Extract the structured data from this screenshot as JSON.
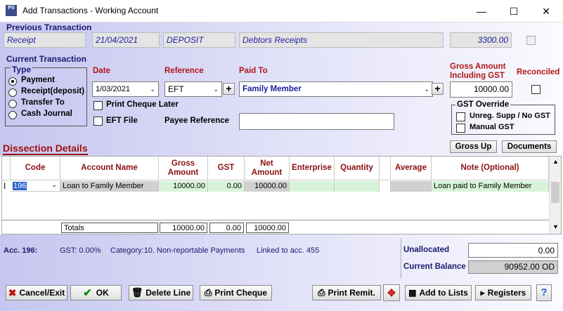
{
  "window": {
    "title": "Add Transactions - Working Account",
    "icon_text": "PS"
  },
  "previous": {
    "title": "Previous Transaction",
    "type": "Receipt",
    "date": "21/04/2021",
    "reference": "DEPOSIT",
    "paid_to": "Debtors Receipts",
    "amount": "3300.00"
  },
  "current": {
    "title": "Current Transaction",
    "type_title": "Type",
    "types": [
      "Payment",
      "Receipt(deposit)",
      "Transfer To",
      "Cash Journal"
    ],
    "selected_type": "Payment",
    "date_label": "Date",
    "date_value": "1/03/2021",
    "reference_label": "Reference",
    "reference_value": "EFT",
    "paid_to_label": "Paid To",
    "paid_to_value": "Family Member",
    "gross_label": "Gross Amount Including GST",
    "gross_value": "10000.00",
    "reconciled_label": "Reconciled",
    "print_cheque_later": "Print Cheque Later",
    "eft_file": "EFT File",
    "payee_reference_label": "Payee Reference",
    "payee_reference_value": "",
    "gst_override_title": "GST Override",
    "unreg_supp": "Unreg. Supp / No GST",
    "manual_gst": "Manual GST",
    "gross_up_button": "Gross Up",
    "documents_button": "Documents"
  },
  "dissection": {
    "title": "Dissection Details",
    "columns": [
      "Code",
      "Account Name",
      "Gross Amount",
      "GST",
      "Net Amount",
      "Enterprise",
      "Quantity",
      "Average",
      "Note (Optional)"
    ],
    "row": {
      "code": "196",
      "account_name": "Loan to Family Member",
      "gross": "10000.00",
      "gst": "0.00",
      "net": "10000.00",
      "enterprise": "",
      "quantity": "",
      "average": "",
      "note": "Loan paid to Family Member"
    },
    "totals_label": "Totals",
    "totals": {
      "gross": "10000.00",
      "gst": "0.00",
      "net": "10000.00"
    }
  },
  "info": {
    "account": "Acc. 196:",
    "gst": "GST: 0.00%",
    "category": "Category:10. Non-reportable Payments",
    "linked": "Linked to acc. 455",
    "unallocated_label": "Unallocated",
    "unallocated_value": "0.00",
    "balance_label": "Current Balance",
    "balance_value": "90952.00 OD"
  },
  "buttons": {
    "cancel": "Cancel/Exit",
    "ok": "OK",
    "delete_line": "Delete Line",
    "print_cheque": "Print Cheque",
    "print_remit": "Print Remit.",
    "add_to_lists": "Add to Lists",
    "registers": "Registers",
    "help": "?"
  }
}
